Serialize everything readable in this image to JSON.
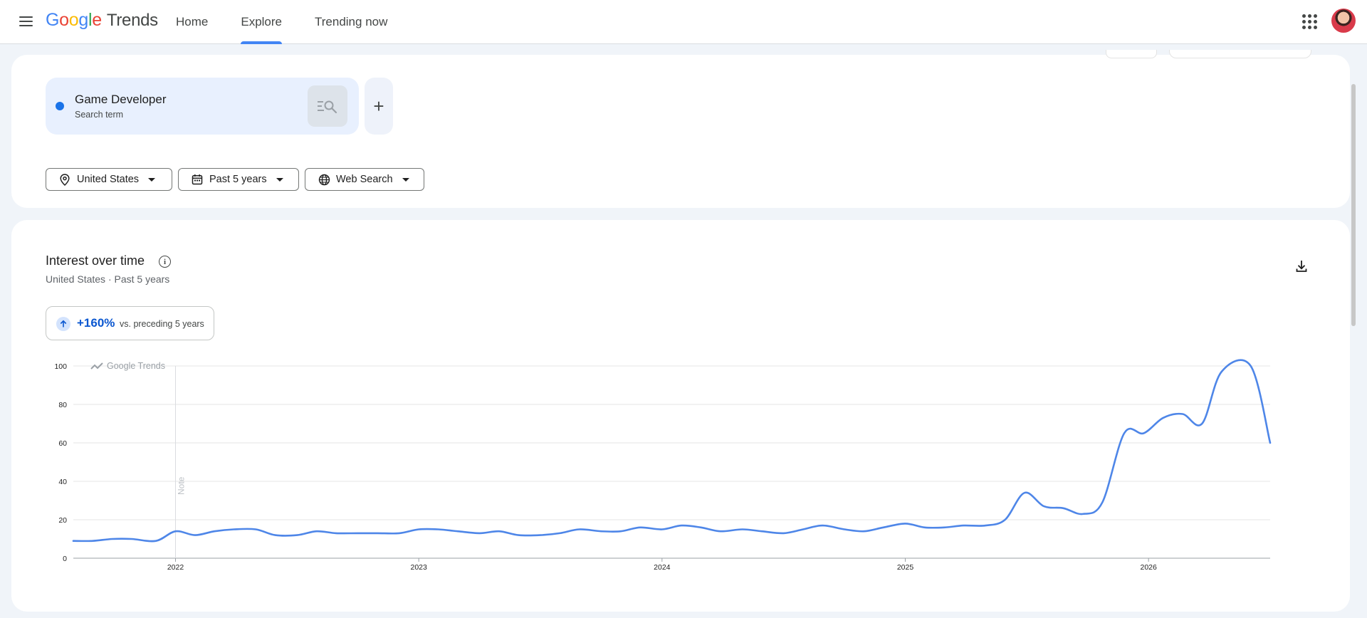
{
  "app": {
    "logo_letters": [
      {
        "ch": "G",
        "color": "#4285F4"
      },
      {
        "ch": "o",
        "color": "#EA4335"
      },
      {
        "ch": "o",
        "color": "#FBBC05"
      },
      {
        "ch": "g",
        "color": "#4285F4"
      },
      {
        "ch": "l",
        "color": "#34A853"
      },
      {
        "ch": "e",
        "color": "#EA4335"
      }
    ],
    "logo_suffix": "Trends"
  },
  "nav": {
    "tabs": [
      {
        "label": "Home",
        "active": false
      },
      {
        "label": "Explore",
        "active": true
      },
      {
        "label": "Trending now",
        "active": false
      }
    ]
  },
  "query": {
    "term": "Game Developer",
    "term_type": "Search term",
    "term_color": "#1a73e8",
    "add_label": "+"
  },
  "filters": {
    "geo": "United States",
    "time": "Past 5 years",
    "property": "Web Search"
  },
  "interest": {
    "title": "Interest over time",
    "subtitle": "United States · Past 5 years",
    "change_value": "+160%",
    "change_label": "vs. preceding 5 years",
    "watermark": "Google Trends",
    "note": "Note"
  },
  "chart_data": {
    "type": "line",
    "title": "Interest over time",
    "xlabel": "",
    "ylabel": "",
    "x_ticks": [
      "2022",
      "2023",
      "2024",
      "2025",
      "2026"
    ],
    "y_ticks": [
      0,
      20,
      40,
      60,
      80,
      100
    ],
    "ylim": [
      0,
      100
    ],
    "xlim": [
      2021.58,
      2026.5
    ],
    "grid": true,
    "note_at": 2022.0,
    "series": [
      {
        "color": "#4e86e8",
        "points": [
          [
            2021.58,
            9
          ],
          [
            2021.66,
            9
          ],
          [
            2021.74,
            10
          ],
          [
            2021.82,
            10
          ],
          [
            2021.92,
            9
          ],
          [
            2022.0,
            14
          ],
          [
            2022.08,
            12
          ],
          [
            2022.16,
            14
          ],
          [
            2022.24,
            15
          ],
          [
            2022.33,
            15
          ],
          [
            2022.41,
            12
          ],
          [
            2022.5,
            12
          ],
          [
            2022.58,
            14
          ],
          [
            2022.66,
            13
          ],
          [
            2022.75,
            13
          ],
          [
            2022.83,
            13
          ],
          [
            2022.92,
            13
          ],
          [
            2023.0,
            15
          ],
          [
            2023.08,
            15
          ],
          [
            2023.16,
            14
          ],
          [
            2023.25,
            13
          ],
          [
            2023.33,
            14
          ],
          [
            2023.41,
            12
          ],
          [
            2023.5,
            12
          ],
          [
            2023.58,
            13
          ],
          [
            2023.66,
            15
          ],
          [
            2023.75,
            14
          ],
          [
            2023.83,
            14
          ],
          [
            2023.91,
            16
          ],
          [
            2024.0,
            15
          ],
          [
            2024.08,
            17
          ],
          [
            2024.16,
            16
          ],
          [
            2024.24,
            14
          ],
          [
            2024.33,
            15
          ],
          [
            2024.41,
            14
          ],
          [
            2024.5,
            13
          ],
          [
            2024.58,
            15
          ],
          [
            2024.66,
            17
          ],
          [
            2024.75,
            15
          ],
          [
            2024.83,
            14
          ],
          [
            2024.91,
            16
          ],
          [
            2025.0,
            18
          ],
          [
            2025.08,
            16
          ],
          [
            2025.16,
            16
          ],
          [
            2025.24,
            17
          ],
          [
            2025.33,
            17
          ],
          [
            2025.41,
            20
          ],
          [
            2025.49,
            34
          ],
          [
            2025.57,
            27
          ],
          [
            2025.65,
            26
          ],
          [
            2025.73,
            23
          ],
          [
            2025.81,
            29
          ],
          [
            2025.9,
            65
          ],
          [
            2025.98,
            65
          ],
          [
            2026.06,
            73
          ],
          [
            2026.14,
            75
          ],
          [
            2026.22,
            70
          ],
          [
            2026.3,
            97
          ],
          [
            2026.42,
            100
          ],
          [
            2026.5,
            60
          ]
        ]
      }
    ]
  }
}
